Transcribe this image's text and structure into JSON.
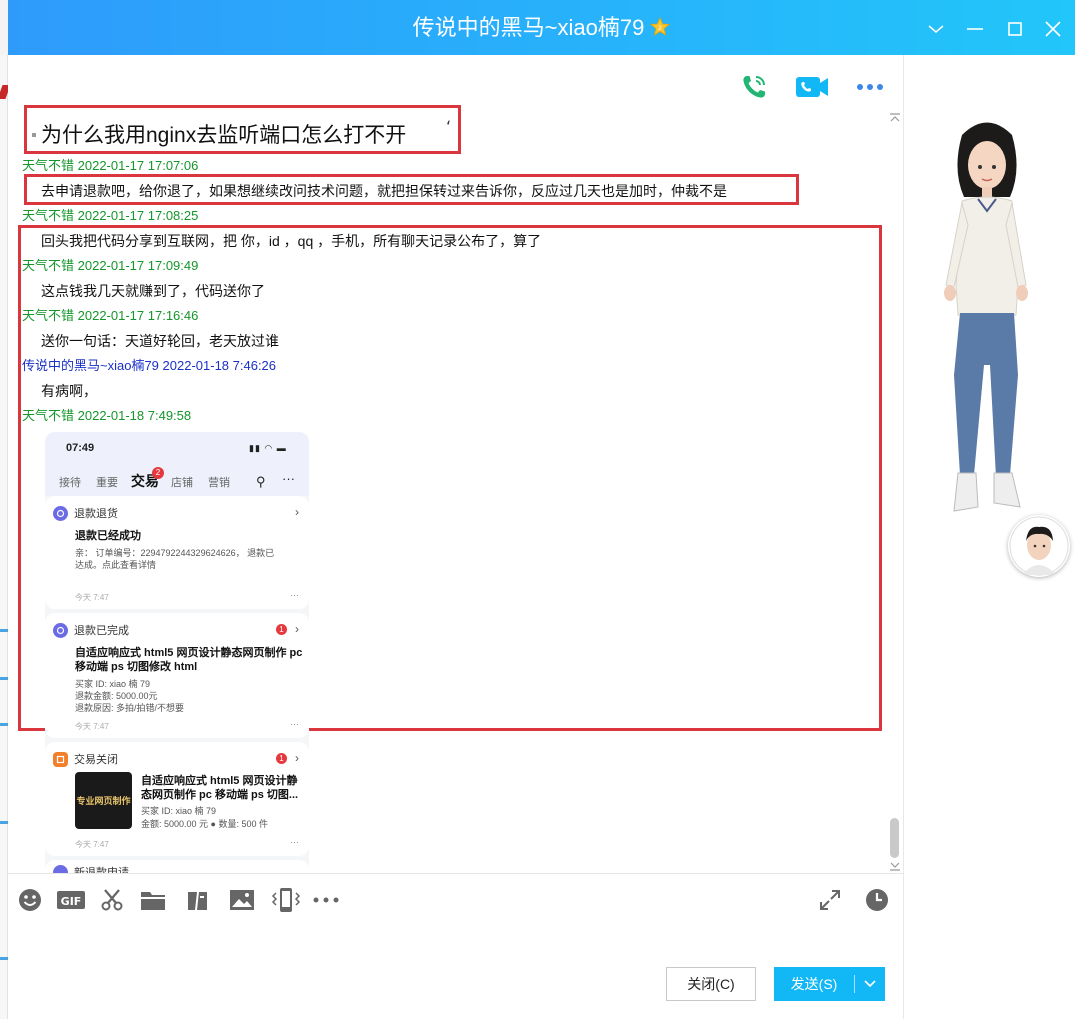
{
  "window": {
    "title": "传说中的黑马~xiao楠79",
    "star_icon": "vip-star-icon",
    "accent": "#2ea8fb"
  },
  "toolbar_top": {
    "icons": [
      "voice-call-icon",
      "video-call-icon",
      "more-icon"
    ]
  },
  "messages": {
    "highlight_title": "为什么我用nginx去监听端口怎么打不开",
    "highlight_tick": "‘",
    "items": [
      {
        "sender": "天气不错",
        "time": "2022-01-17 17:07:06",
        "text": "去申请退款吧，给你退了，如果想继续改问技术问题，就把担保转过来告诉你，反应过几天也是加时，仲裁不是"
      },
      {
        "sender": "天气不错",
        "time": "2022-01-17 17:08:25",
        "text": "回头我把代码分享到互联网，把 你，id ，qq ，手机，所有聊天记录公布了，算了"
      },
      {
        "sender": "天气不错",
        "time": "2022-01-17 17:09:49",
        "text": "这点钱我几天就赚到了，代码送你了"
      },
      {
        "sender": "天气不错",
        "time": "2022-01-17 17:16:46",
        "text": "送你一句话：天道好轮回，老天放过谁"
      },
      {
        "sender": "传说中的黑马~xiao楠79",
        "time": "2022-01-18 7:46:26",
        "text": "有病啊，"
      },
      {
        "sender": "天气不错",
        "time": "2022-01-18 7:49:58",
        "text": ""
      }
    ]
  },
  "phone_screenshot": {
    "time": "07:49",
    "tabs": [
      "接待",
      "重要",
      "交易",
      "店铺",
      "营销"
    ],
    "active_tab": "交易",
    "tab_badge": "2",
    "cards": [
      {
        "header": "退款退货",
        "title": "退款已经成功",
        "lines": [
          "亲：  订单编号：2294792244329624626，  退款已",
          "达成。点此查看详情"
        ],
        "footer": "今天 7:47",
        "badge": ""
      },
      {
        "header": "退款已完成",
        "title_lines": [
          "自适应响应式 html5 网页设计静态网页制作 pc",
          "移动端 ps 切图修改 html"
        ],
        "lines": [
          "买家 ID: xiao 楠 79",
          "退款金额: 5000.00元",
          "退款原因: 多拍/拍错/不想要"
        ],
        "footer": "今天 7:47",
        "badge": "1"
      },
      {
        "header": "交易关闭",
        "title_lines": [
          "自适应响应式 html5 网页设计静",
          "态网页制作 pc 移动端 ps 切图..."
        ],
        "lines": [
          "买家 ID: xiao 楠 79",
          "金额: 5000.00 元 ● 数量: 500 件"
        ],
        "thumb_text": "专业网页制作",
        "footer": "今天 7:47",
        "badge": "1"
      }
    ],
    "partial_header": "新退款申请"
  },
  "input_toolbar": {
    "icons": [
      "emoji-icon",
      "gif-icon",
      "scissors-icon",
      "folder-icon",
      "file-transfer-icon",
      "image-icon",
      "phone-shake-icon",
      "more-icon"
    ],
    "right_icons": [
      "expand-icon",
      "history-clock-icon"
    ]
  },
  "buttons": {
    "close": "关闭(C)",
    "send": "发送(S)"
  }
}
